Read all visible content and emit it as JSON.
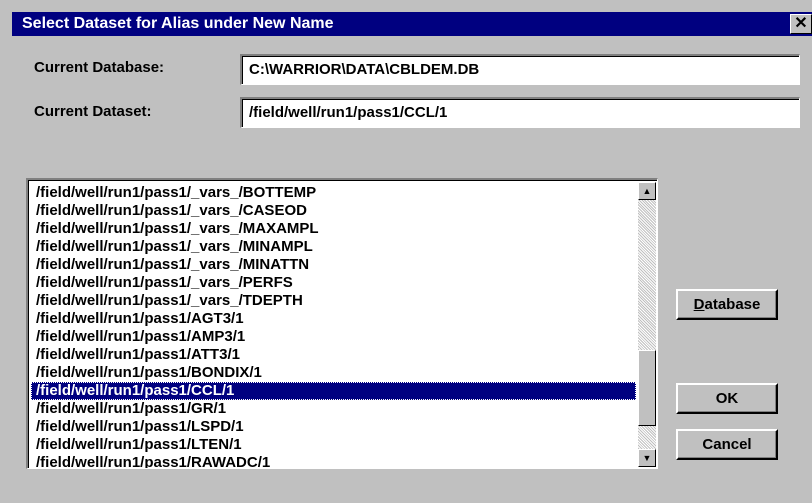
{
  "window": {
    "title": "Select Dataset for Alias under New Name",
    "close_glyph": "✕"
  },
  "fields": {
    "database_label": "Current Database:",
    "database_value": "C:\\WARRIOR\\DATA\\CBLDEM.DB",
    "dataset_label": "Current Dataset:",
    "dataset_value": "/field/well/run1/pass1/CCL/1"
  },
  "list": {
    "items": [
      "/field/well/run1/pass1/_vars_/BOTTEMP",
      "/field/well/run1/pass1/_vars_/CASEOD",
      "/field/well/run1/pass1/_vars_/MAXAMPL",
      "/field/well/run1/pass1/_vars_/MINAMPL",
      "/field/well/run1/pass1/_vars_/MINATTN",
      "/field/well/run1/pass1/_vars_/PERFS",
      "/field/well/run1/pass1/_vars_/TDEPTH",
      "/field/well/run1/pass1/AGT3/1",
      "/field/well/run1/pass1/AMP3/1",
      "/field/well/run1/pass1/ATT3/1",
      "/field/well/run1/pass1/BONDIX/1",
      "/field/well/run1/pass1/CCL/1",
      "/field/well/run1/pass1/GR/1",
      "/field/well/run1/pass1/LSPD/1",
      "/field/well/run1/pass1/LTEN/1",
      "/field/well/run1/pass1/RAWADC/1"
    ],
    "selected_index": 11,
    "scroll_up_glyph": "▲",
    "scroll_down_glyph": "▼"
  },
  "buttons": {
    "database_first": "D",
    "database_rest": "atabase",
    "ok": "OK",
    "cancel": "Cancel"
  },
  "colors": {
    "titlebar": "#000080",
    "selection": "#000080",
    "face": "#c0c0c0"
  }
}
